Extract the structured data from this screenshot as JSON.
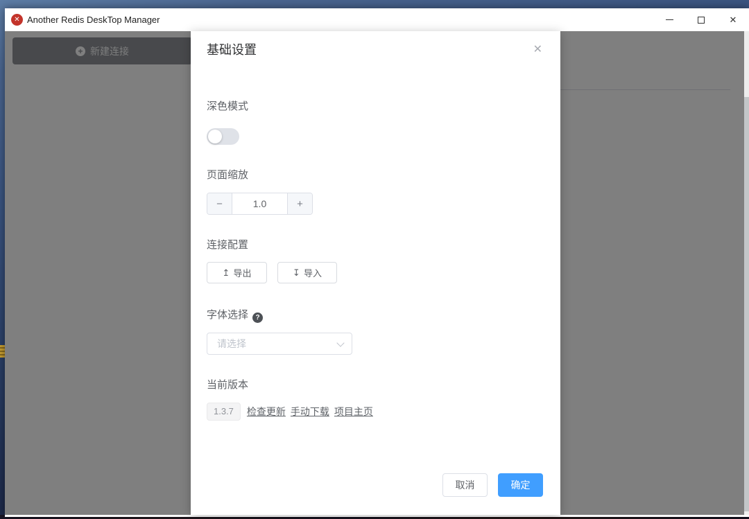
{
  "titlebar": {
    "app_title": "Another Redis DeskTop Manager",
    "app_icon_glyph": "✕"
  },
  "window_controls": {
    "close_glyph": "✕"
  },
  "sidebar": {
    "new_connection_label": "新建连接",
    "plus_glyph": "+"
  },
  "dialog": {
    "title": "基础设置",
    "close_glyph": "✕",
    "sections": {
      "dark_mode": {
        "label": "深色模式",
        "enabled": false
      },
      "page_zoom": {
        "label": "页面缩放",
        "value": "1.0",
        "decrease_glyph": "−",
        "increase_glyph": "+"
      },
      "connection_config": {
        "label": "连接配置",
        "export_label": "导出",
        "export_icon_glyph": "↥",
        "import_label": "导入",
        "import_icon_glyph": "↧"
      },
      "font_select": {
        "label": "字体选择",
        "help_glyph": "?",
        "placeholder": "请选择"
      },
      "version": {
        "label": "当前版本",
        "current": "1.3.7",
        "links": [
          "检查更新",
          "手动下载",
          "项目主页"
        ]
      }
    },
    "footer": {
      "cancel": "取消",
      "ok": "确定"
    }
  },
  "colors": {
    "accent": "#409eff",
    "overlay": "rgba(0,0,0,0.5)",
    "app_icon_red": "#c3342b",
    "sidebar_button_gray": "#909399"
  }
}
